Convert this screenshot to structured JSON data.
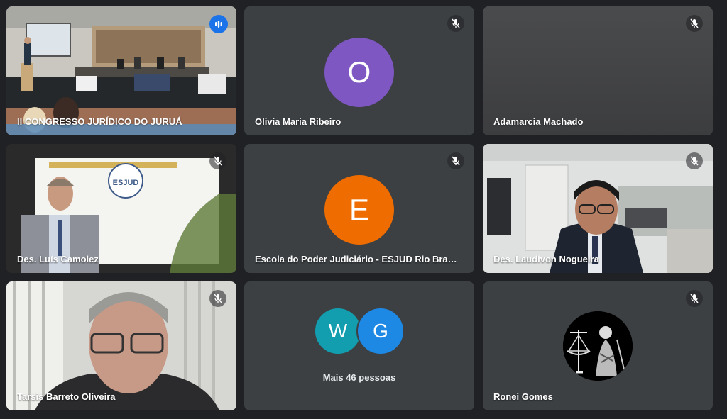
{
  "tiles": [
    {
      "name": "II CONGRESSO JURÍDICO DO JURUÁ",
      "kind": "video-conference-room",
      "speaking": true
    },
    {
      "name": "Olivia Maria Ribeiro",
      "initial": "O",
      "avatar_color": "#7e57c2",
      "muted": true
    },
    {
      "name": "Adamarcia Machado",
      "kind": "video-dark",
      "muted": true
    },
    {
      "name": "Des. Luís Camolez",
      "kind": "video-speaker",
      "muted": true
    },
    {
      "name": "Escola do Poder Judiciário - ESJUD Rio Branco",
      "initial": "E",
      "avatar_color": "#ef6c00",
      "muted": true
    },
    {
      "name": "Des. Laudivon Nogueira",
      "kind": "video-office",
      "muted": true
    },
    {
      "name": "Tarsis Barreto Oliveira",
      "kind": "video-closeup",
      "muted": true
    },
    {
      "more": {
        "initials": [
          "W",
          "G"
        ],
        "colors": [
          "#129eaf",
          "#1e88e5"
        ],
        "label": "Mais 46 pessoas"
      }
    },
    {
      "name": "Ronei Gomes",
      "kind": "avatar-image",
      "muted": true
    }
  ],
  "stage": {
    "banner_text": "ESJUD"
  },
  "icons": {
    "mute": "mic-off-icon",
    "speaking": "audio-bars-icon"
  }
}
